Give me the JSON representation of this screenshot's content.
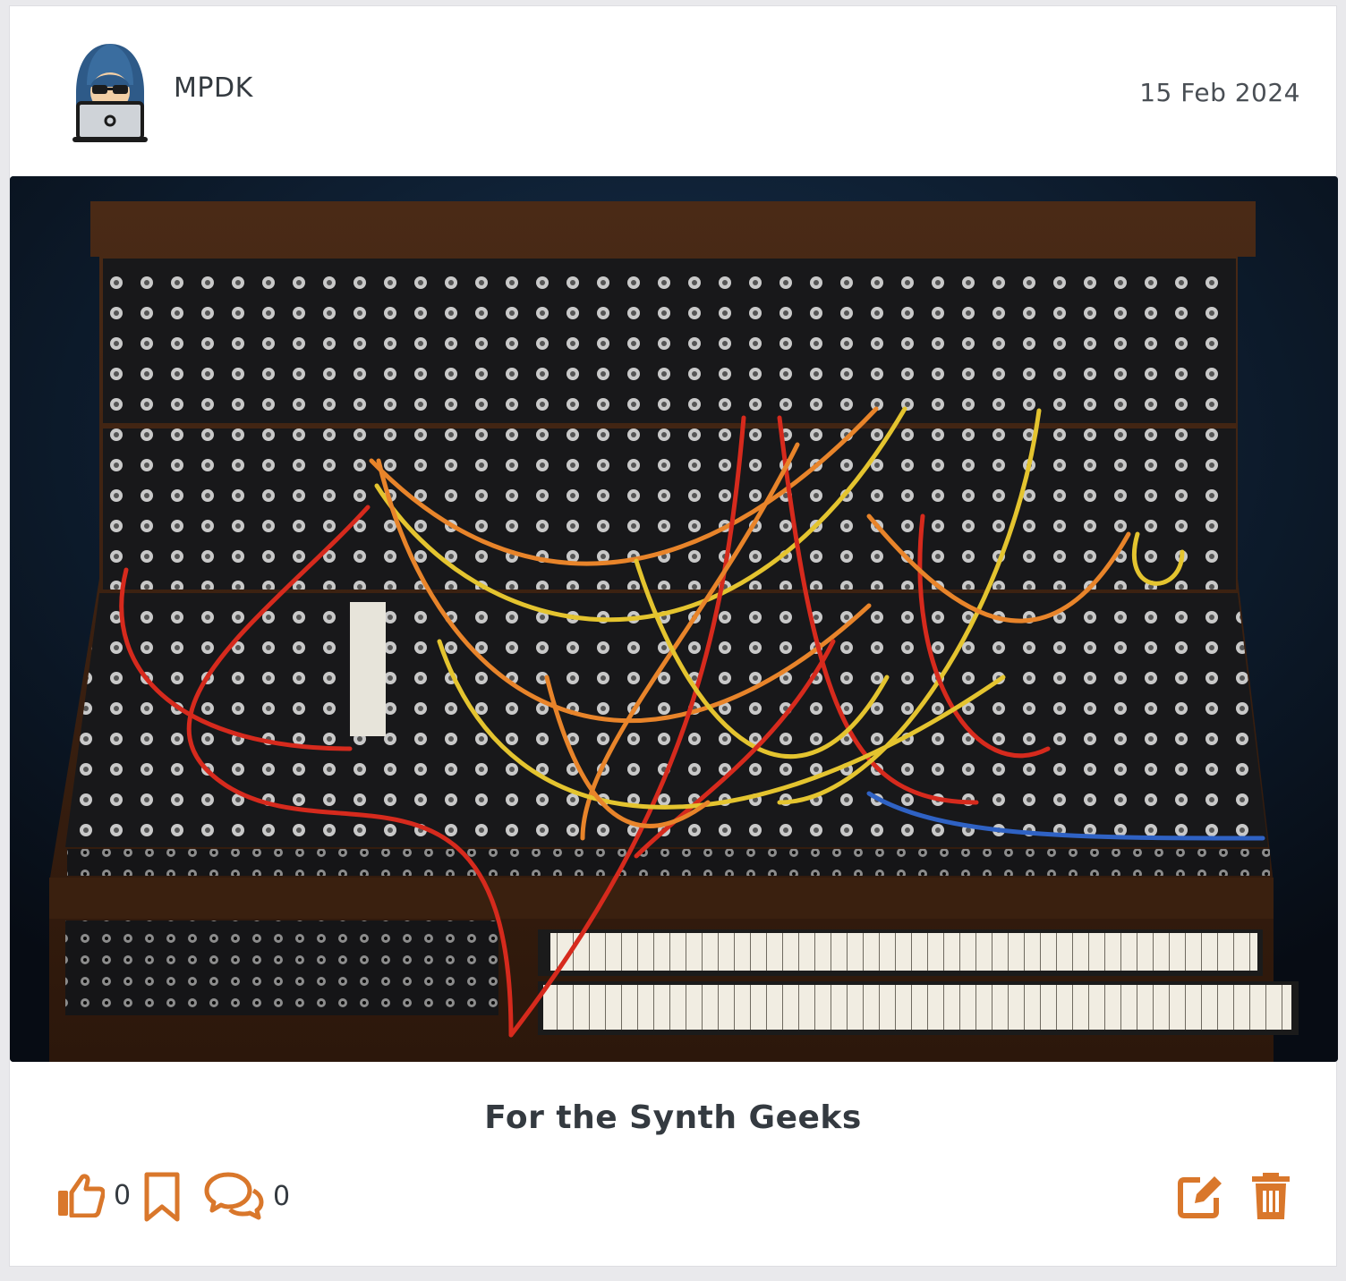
{
  "post": {
    "author": "MPDK",
    "date": "15 Feb 2024",
    "title": "For the Synth Geeks",
    "likes": "0",
    "comments": "0"
  },
  "icons": {
    "avatar": "hacker-avatar-icon",
    "like": "thumbs-up-icon",
    "bookmark": "bookmark-icon",
    "comments": "comments-icon",
    "edit": "edit-icon",
    "delete": "trash-icon"
  },
  "colors": {
    "accent": "#d9772b",
    "text": "#343a40"
  }
}
